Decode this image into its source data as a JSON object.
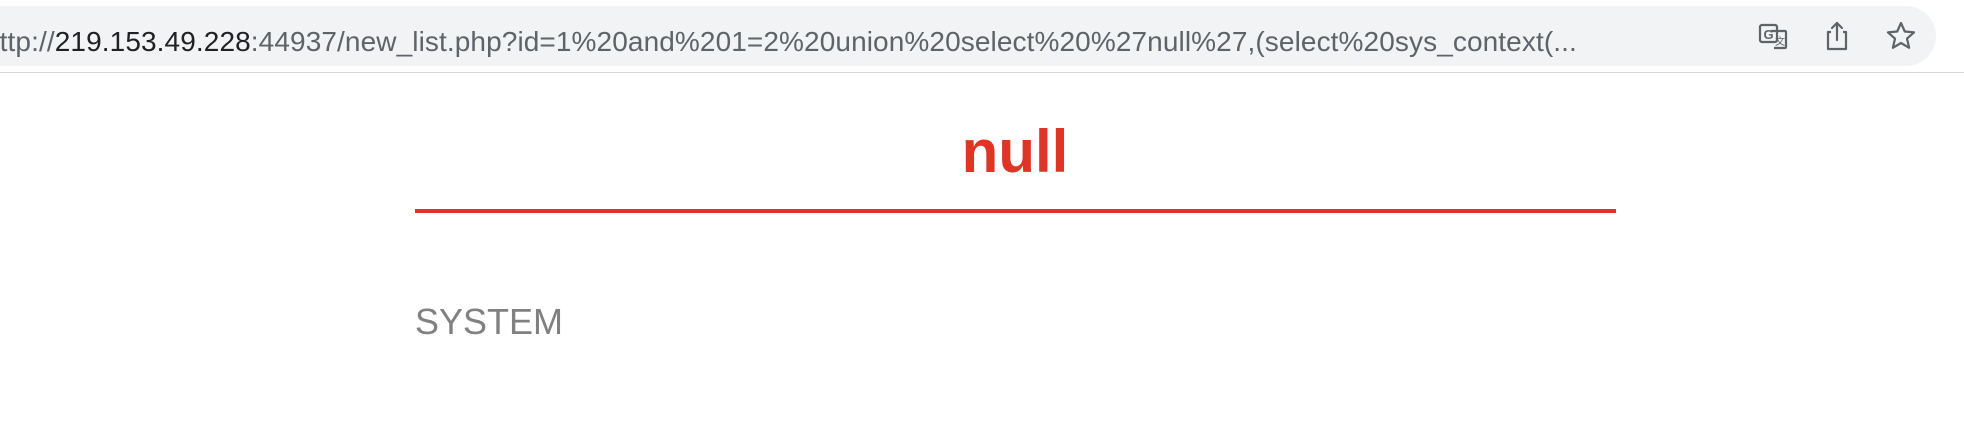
{
  "browser": {
    "url": {
      "scheme": "http://",
      "host": "219.153.49.228",
      "rest": ":44937/new_list.php?id=1%20and%201=2%20union%20select%20%27null%27,(select%20sys_context(..."
    },
    "icons": [
      "translate-icon",
      "share-icon",
      "bookmark-star-icon"
    ]
  },
  "page": {
    "title": "null",
    "content": "SYSTEM"
  },
  "colors": {
    "accent": "#e03524",
    "body_text": "#808080",
    "omnibox_bg": "#f1f3f4"
  }
}
